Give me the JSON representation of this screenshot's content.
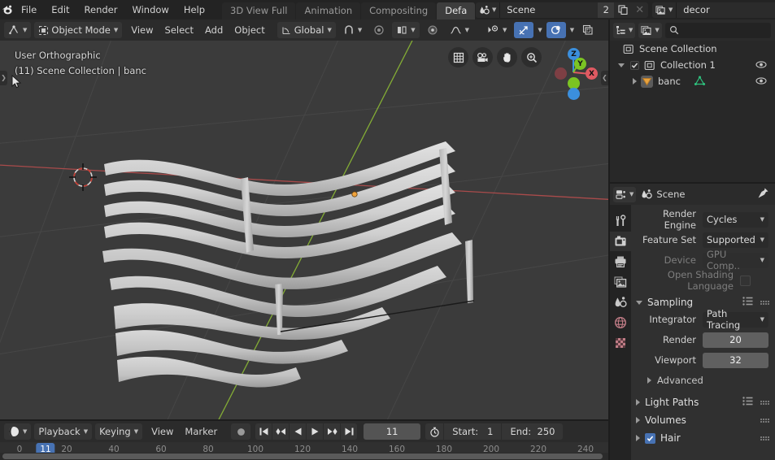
{
  "topbar": {
    "logo_icon": "blender-logo-icon",
    "menus": [
      "File",
      "Edit",
      "Render",
      "Window",
      "Help"
    ],
    "workspace_tabs": [
      {
        "label": "3D View Full",
        "active": false
      },
      {
        "label": "Animation",
        "active": false
      },
      {
        "label": "Compositing",
        "active": false
      },
      {
        "label": "Defa",
        "active": true
      }
    ],
    "scene": {
      "icon": "scene-icon",
      "name": "Scene",
      "users_count": "2",
      "new_icon": "duplicate-icon",
      "unlink_icon": "close-icon"
    },
    "view_layer": {
      "icon": "view-layer-icon",
      "name": "decor",
      "new_icon": "duplicate-icon",
      "unlink_icon": "close-icon"
    }
  },
  "viewport": {
    "header": {
      "editor_type_icon": "editor-type-3dview-icon",
      "mode_icon": "object-mode-icon",
      "mode_label": "Object Mode",
      "menus": [
        "View",
        "Select",
        "Add",
        "Object"
      ],
      "transform_orientation_icon": "orientation-icon",
      "transform_orientation": "Global",
      "snap_icon": "magnet-icon",
      "proportional_edit_icon": "proportional-edit-icon",
      "proportional_falloff_icon": "falloff-smooth-icon",
      "mirror_icon": "mirror-icon",
      "visibility_icon": "visibility-icon",
      "gizmo_icon": "gizmo-icon",
      "overlays_icon": "overlays-icon",
      "xray_icon": "xray-icon"
    },
    "overlay_line1": "User Orthographic",
    "overlay_line2": "(11) Scene Collection | banc",
    "nav_tools": [
      "grid-icon",
      "camera-icon",
      "hand-icon",
      "zoom-icon"
    ],
    "gizmo_axes": [
      {
        "label": "Z",
        "color": "#3b8fdd"
      },
      {
        "label": "Y",
        "color": "#7bc423"
      },
      {
        "label": "X",
        "color": "#e05a62"
      }
    ],
    "object_name": "banc",
    "background_color": "#3b3b3b",
    "model_color": "#d0d0d0"
  },
  "timeline": {
    "editor_type_icon": "editor-type-timeline-icon",
    "menus": [
      "Playback",
      "Keying",
      "View",
      "Marker"
    ],
    "record_icon": "record-icon",
    "transport": [
      "jump-to-start-icon",
      "jump-to-prev-keyframe-icon",
      "play-reverse-icon",
      "play-icon",
      "jump-to-next-keyframe-icon",
      "jump-to-end-icon"
    ],
    "current_frame": "11",
    "auto_key_icon": "stopwatch-icon",
    "start_label": "Start:",
    "start_value": "1",
    "end_label": "End:",
    "end_value": "250",
    "ruler_ticks": [
      "0",
      "20",
      "40",
      "60",
      "80",
      "100",
      "120",
      "140",
      "160",
      "180",
      "200",
      "220",
      "240"
    ],
    "playhead_label": "11",
    "playhead_color": "#4772b3"
  },
  "outliner": {
    "editor_type_icon": "editor-type-outliner-icon",
    "display_mode_icon": "view-layer-icon",
    "search_icon": "search-icon",
    "search_placeholder": "",
    "rows": [
      {
        "label": "Scene Collection",
        "icon": "collection-icon",
        "indent": 14,
        "expander": "",
        "checkbox": false,
        "eye": false
      },
      {
        "label": "Collection 1",
        "icon": "collection-icon",
        "indent": 24,
        "expander": "down",
        "checkbox": true,
        "eye": true
      },
      {
        "label": "banc",
        "icon": "mesh-object-icon",
        "indent": 44,
        "expander": "right",
        "checkbox": false,
        "eye": true,
        "data_icon": "mesh-data-icon"
      }
    ]
  },
  "properties": {
    "editor_type_icon": "editor-type-properties-icon",
    "breadcrumb_icon": "scene-icon",
    "breadcrumb": "Scene",
    "pin_icon": "pin-icon",
    "tabs": [
      {
        "name": "tool-tab",
        "icon": "wrench-screwdriver-icon",
        "active": false
      },
      {
        "name": "render-tab",
        "icon": "camera-back-icon",
        "active": true
      },
      {
        "name": "output-tab",
        "icon": "printer-icon",
        "active": false
      },
      {
        "name": "view-layer-tab",
        "icon": "images-icon",
        "active": false
      },
      {
        "name": "scene-tab",
        "icon": "cone-droplet-icon",
        "active": false
      },
      {
        "name": "world-tab",
        "icon": "globe-icon",
        "active": false
      },
      {
        "name": "texture-tab",
        "icon": "checker-icon",
        "active": false
      }
    ],
    "render_engine_label": "Render Engine",
    "render_engine_value": "Cycles",
    "feature_set_label": "Feature Set",
    "feature_set_value": "Supported",
    "device_label": "Device",
    "device_value": "GPU Comp..",
    "osl_label": "Open Shading Language",
    "panels": [
      {
        "title": "Sampling",
        "open": true,
        "has_preset": true,
        "rows": [
          {
            "label": "Integrator",
            "value": "Path Tracing",
            "type": "dropdown"
          },
          {
            "label": "Render",
            "value": "20",
            "type": "number"
          },
          {
            "label": "Viewport",
            "value": "32",
            "type": "number"
          }
        ],
        "subpanel": "Advanced"
      },
      {
        "title": "Light Paths",
        "open": false,
        "has_preset": true
      },
      {
        "title": "Volumes",
        "open": false,
        "has_preset": false
      },
      {
        "title": "Hair",
        "open": false,
        "has_preset": false,
        "checkbox": true
      }
    ]
  },
  "colors": {
    "accent_blue": "#4772b3",
    "topbar_bg": "#232323",
    "header_bg": "#2b2b2b",
    "panel_bg": "#303030",
    "outliner_bg": "#282828",
    "viewport_bg": "#3b3b3b",
    "axis_x_red": "#c14d4d",
    "axis_y_green": "#8cb935",
    "object_orange": "#e8a33d"
  }
}
